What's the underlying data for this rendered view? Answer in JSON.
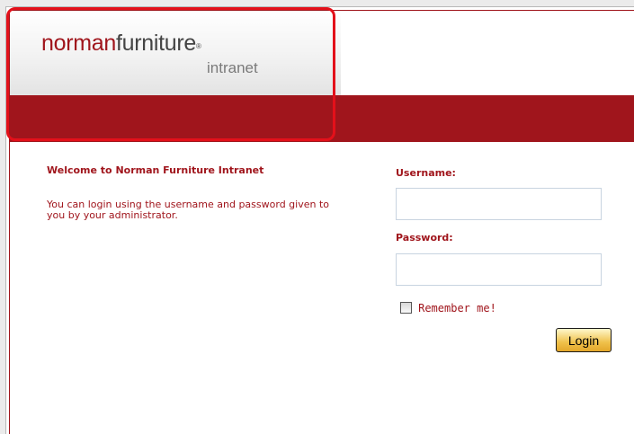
{
  "header": {
    "logo_norman": "norman",
    "logo_furniture": "furniture",
    "logo_registered": "®",
    "logo_sub": "intranet"
  },
  "welcome": {
    "title": "Welcome to Norman Furniture Intranet",
    "text": "You can login using the username and password given to you by your administrator."
  },
  "login_form": {
    "username_label": "Username:",
    "username_value": "",
    "password_label": "Password:",
    "password_value": "",
    "remember_label": "Remember me!",
    "remember_checked": false,
    "login_button": "Login"
  },
  "colors": {
    "brand_red": "#a0151c",
    "highlight_red": "#e3101a",
    "button_gold": "#f0c14b"
  }
}
